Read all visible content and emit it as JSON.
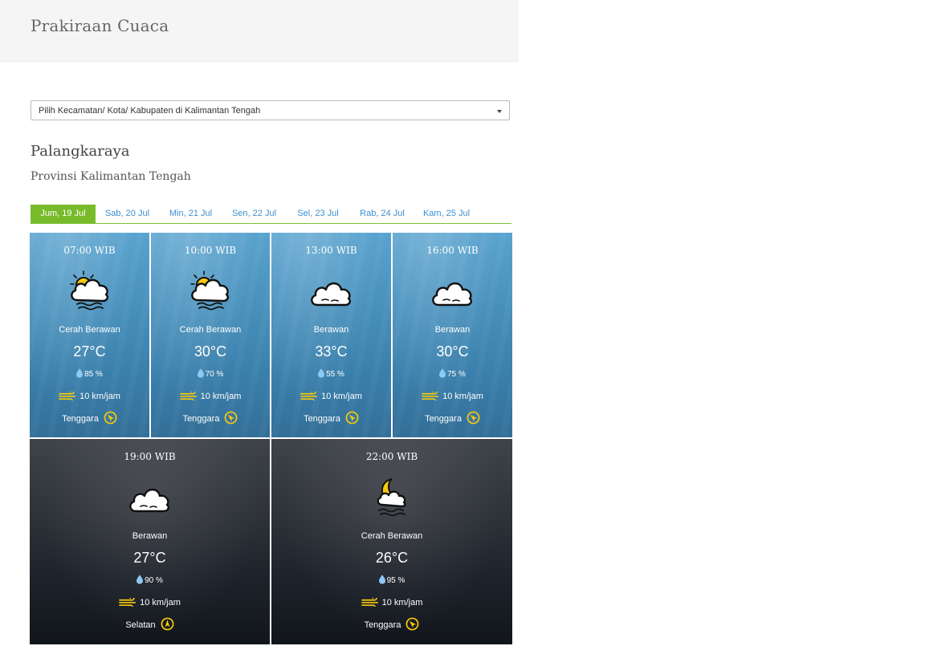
{
  "header": {
    "title": "Prakiraan Cuaca"
  },
  "location_select": {
    "value": "Pilih Kecamatan/ Kota/ Kabupaten di Kalimantan Tengah"
  },
  "city": "Palangkaraya",
  "province": "Provinsi Kalimantan Tengah",
  "tabs": [
    "Jum, 19 Jul",
    "Sab, 20 Jul",
    "Min, 21 Jul",
    "Sen, 22 Jul",
    "Sel, 23 Jul",
    "Rab, 24 Jul",
    "Kam, 25 Jul"
  ],
  "active_tab": 0,
  "colors": {
    "accent": "#78bb2a",
    "tab_link": "#3b8fd1",
    "icon_yellow": "#f6c90e"
  },
  "forecasts": [
    {
      "time": "07:00 WIB",
      "condition": "Cerah Berawan",
      "icon": "sun-cloud-icon",
      "temp": "27°C",
      "humidity": "85 %",
      "wind": "10 km/jam",
      "direction": "Tenggara",
      "period": "day"
    },
    {
      "time": "10:00 WIB",
      "condition": "Cerah Berawan",
      "icon": "sun-cloud-icon",
      "temp": "30°C",
      "humidity": "70 %",
      "wind": "10 km/jam",
      "direction": "Tenggara",
      "period": "day"
    },
    {
      "time": "13:00 WIB",
      "condition": "Berawan",
      "icon": "cloud-icon",
      "temp": "33°C",
      "humidity": "55 %",
      "wind": "10 km/jam",
      "direction": "Tenggara",
      "period": "day"
    },
    {
      "time": "16:00 WIB",
      "condition": "Berawan",
      "icon": "cloud-icon",
      "temp": "30°C",
      "humidity": "75 %",
      "wind": "10 km/jam",
      "direction": "Tenggara",
      "period": "day"
    },
    {
      "time": "19:00 WIB",
      "condition": "Berawan",
      "icon": "cloud-icon",
      "temp": "27°C",
      "humidity": "90 %",
      "wind": "10 km/jam",
      "direction": "Selatan",
      "period": "night"
    },
    {
      "time": "22:00 WIB",
      "condition": "Cerah Berawan",
      "icon": "moon-cloud-icon",
      "temp": "26°C",
      "humidity": "95 %",
      "wind": "10 km/jam",
      "direction": "Tenggara",
      "period": "night"
    }
  ]
}
